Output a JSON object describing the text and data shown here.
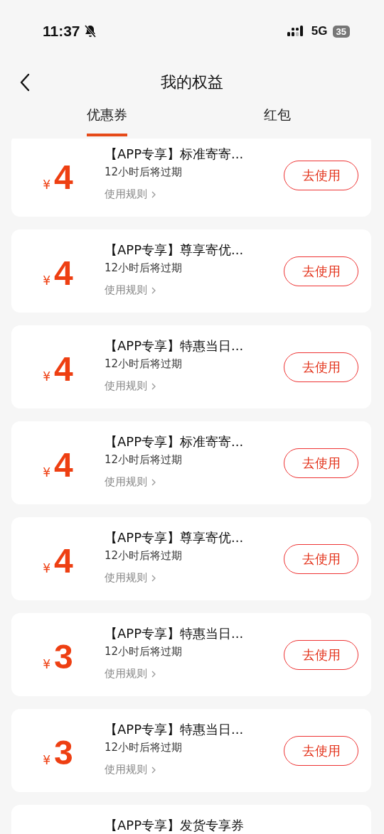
{
  "status_bar": {
    "time": "11:37",
    "network": "5G",
    "battery": "35"
  },
  "header": {
    "title": "我的权益"
  },
  "tabs": [
    {
      "label": "优惠券",
      "selected": true
    },
    {
      "label": "红包",
      "selected": false
    }
  ],
  "coupons": [
    {
      "currency": "¥",
      "amount": "4",
      "title": "【APP专享】标准寄寄...",
      "expiry": "12小时后将过期",
      "rules_link": "使用规则",
      "button": "去使用"
    },
    {
      "currency": "¥",
      "amount": "4",
      "title": "【APP专享】尊享寄优...",
      "expiry": "12小时后将过期",
      "rules_link": "使用规则",
      "button": "去使用"
    },
    {
      "currency": "¥",
      "amount": "4",
      "title": "【APP专享】特惠当日...",
      "expiry": "12小时后将过期",
      "rules_link": "使用规则",
      "button": "去使用"
    },
    {
      "currency": "¥",
      "amount": "4",
      "title": "【APP专享】标准寄寄...",
      "expiry": "12小时后将过期",
      "rules_link": "使用规则",
      "button": "去使用"
    },
    {
      "currency": "¥",
      "amount": "4",
      "title": "【APP专享】尊享寄优...",
      "expiry": "12小时后将过期",
      "rules_link": "使用规则",
      "button": "去使用"
    },
    {
      "currency": "¥",
      "amount": "3",
      "title": "【APP专享】特惠当日...",
      "expiry": "12小时后将过期",
      "rules_link": "使用规则",
      "button": "去使用"
    },
    {
      "currency": "¥",
      "amount": "3",
      "title": "【APP专享】特惠当日...",
      "expiry": "12小时后将过期",
      "rules_link": "使用规则",
      "button": "去使用"
    },
    {
      "title": "【APP专享】发货专享券"
    }
  ]
}
